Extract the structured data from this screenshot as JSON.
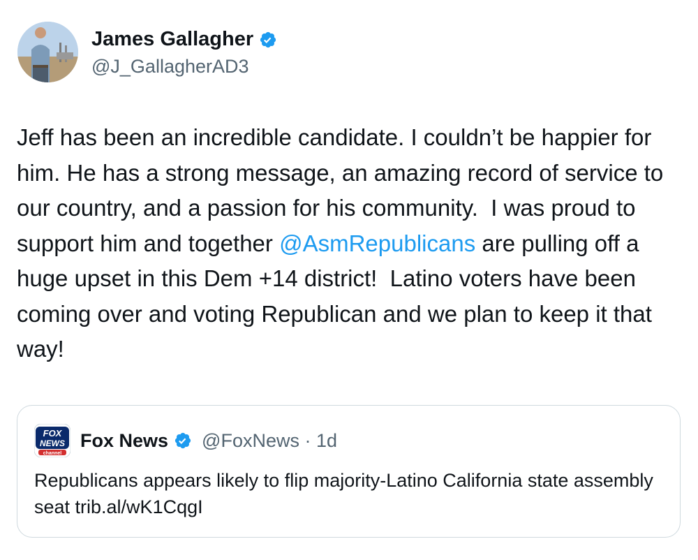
{
  "author": {
    "display_name": "James Gallagher",
    "handle": "@J_GallagherAD3",
    "avatar_icon": "profile-photo",
    "verified_icon": "verified-badge-icon"
  },
  "tweet": {
    "text_part1": "Jeff has been an incredible candidate. I couldn’t be happier for him. He has a strong message, an amazing record of service to our country, and a passion for his community.  I was proud to support him and together ",
    "mention": "@AsmRepublicans",
    "text_part2": " are pulling off a huge upset in this Dem +14 district!  Latino voters have been coming over and voting Republican and we plan to keep it that way!"
  },
  "quote": {
    "logo_icon": "fox-news-logo",
    "logo_text": "FOX NEWS",
    "logo_subtext": "channel",
    "display_name": "Fox News",
    "handle_meta": "@FoxNews · 1d",
    "text": "Republicans appears likely to flip majority-Latino California state assembly seat trib.al/wK1CqgI"
  },
  "colors": {
    "link": "#1d9bf0",
    "text": "#0f1419",
    "secondary": "#536471",
    "border": "#cfd9de"
  }
}
